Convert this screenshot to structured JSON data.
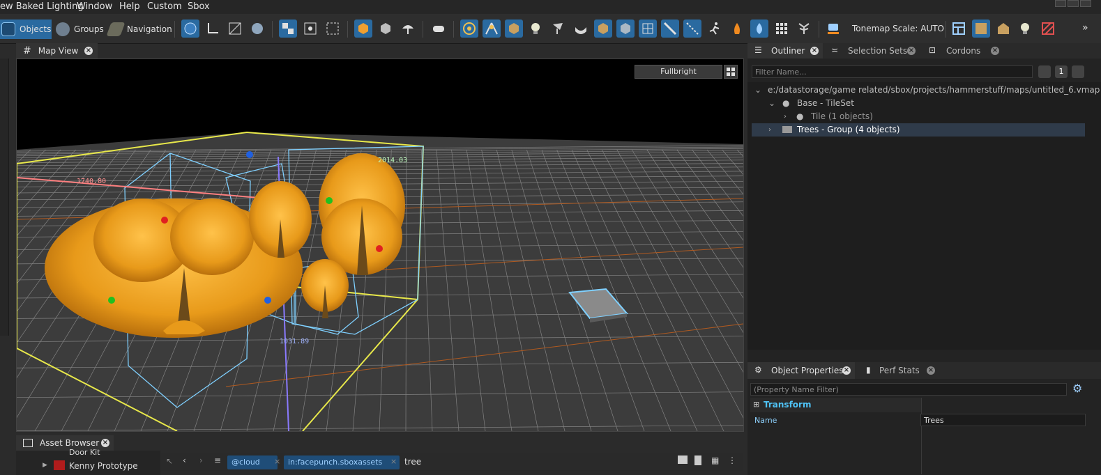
{
  "menu": [
    "ew Baked Lighting",
    "Window",
    "Help",
    "Custom",
    "Sbox"
  ],
  "modes": {
    "objects": "Objects",
    "groups": "Groups",
    "navigation": "Navigation"
  },
  "toolbar": {
    "tonemap_label": "Tonemap Scale: AUTO"
  },
  "map_view": {
    "tab_label": "Map View",
    "fullbright_label": "Fullbright",
    "dimensions": {
      "a": "1740.80",
      "b": "2014.03",
      "c": "1031.89"
    }
  },
  "asset_browser": {
    "tab_label": "Asset Browser",
    "tree_items": [
      "Door Kit",
      "Kenny Prototype"
    ],
    "chips": [
      "@cloud",
      "in:facepunch.sboxassets"
    ],
    "search_value": "tree"
  },
  "outliner": {
    "tabs": [
      "Outliner",
      "Selection Sets",
      "Cordons"
    ],
    "filter_placeholder": "Filter Name...",
    "items": [
      {
        "label": "e:/datastorage/game related/sbox/projects/hammerstuff/maps/untitled_6.vmap"
      },
      {
        "label": "Base - TileSet"
      },
      {
        "label": "Tile (1 objects)"
      },
      {
        "label": "Trees - Group (4 objects)"
      }
    ]
  },
  "properties": {
    "tabs": [
      "Object Properties",
      "Perf Stats"
    ],
    "filter_placeholder": "(Property Name Filter)",
    "section": "Transform",
    "name_label": "Name",
    "name_value": "Trees"
  },
  "colors": {
    "accent": "#2a6aa0",
    "tree": "#e8a21c",
    "selection": "#e8e84a",
    "bounds": "#7fd0ff"
  }
}
